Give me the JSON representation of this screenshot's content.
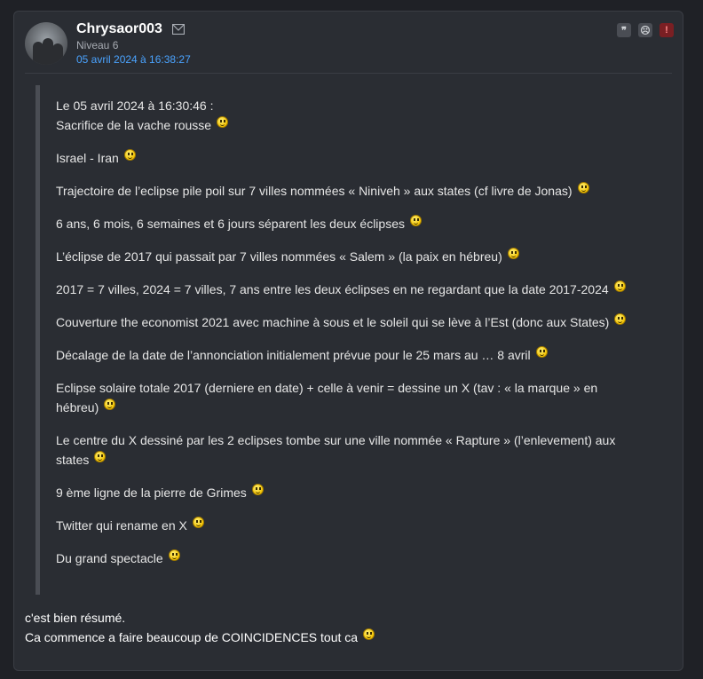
{
  "post": {
    "username": "Chrysaor003",
    "level": "Niveau 6",
    "date": "05 avril 2024 à 16:38:27",
    "actions": [
      "quote",
      "blacklist",
      "report"
    ]
  },
  "quote": {
    "header": "Le 05 avril 2024 à 16:30:46 :",
    "lines": [
      "Sacrifice de la vache rousse",
      "Israel - Iran",
      "Trajectoire de l’eclipse pile poil sur 7 villes nommées « Niniveh » aux states (cf livre de Jonas)",
      "6 ans, 6 mois, 6 semaines et 6 jours séparent les deux éclipses",
      "L’éclipse de 2017 qui passait par 7 villes nommées « Salem » (la paix en hébreu)",
      "2017 = 7 villes, 2024 = 7 villes, 7 ans entre les deux éclipses en ne regardant que la date 2017-2024",
      "Couverture the economist 2021 avec machine à sous et le soleil qui se lève à l’Est (donc aux States)",
      "Décalage de la date de l’annonciation initialement prévue pour le 25 mars au … 8 avril",
      "Eclipse solaire totale 2017 (derniere en date) + celle à venir = dessine un X (tav : « la marque » en",
      "hébreu)",
      "Le centre du X dessiné par les 2 eclipses tombe sur une ville nommée « Rapture » (l’enlevement) aux",
      "states",
      "9 ème ligne de la pierre de Grimes",
      "Twitter qui rename en X",
      "Du grand spectacle"
    ]
  },
  "reply": {
    "line1": "c'est bien résumé.",
    "line2": "Ca commence a faire beaucoup de COINCIDENCES tout ca"
  }
}
